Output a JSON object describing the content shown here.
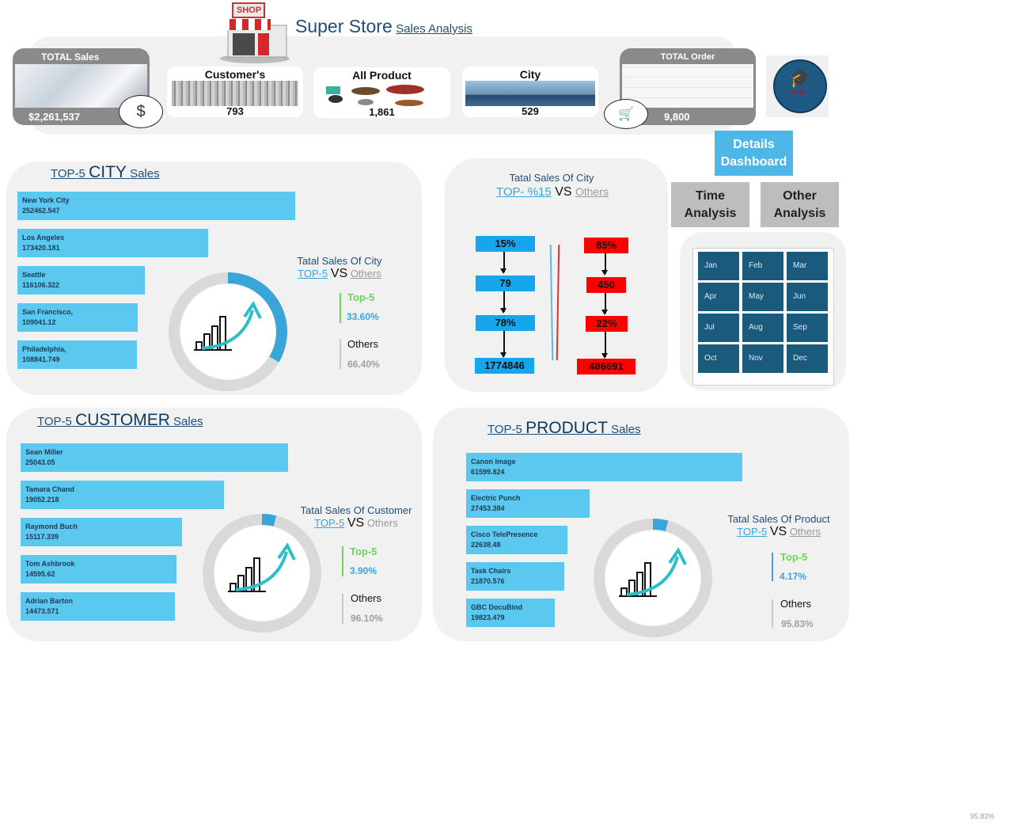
{
  "header": {
    "brand": "Super Store",
    "subtitle": "Sales Analysis",
    "shop_sign": "SHOP"
  },
  "kpis": {
    "total_sales": {
      "label": "TOTAL Sales",
      "value": "$2,261,537"
    },
    "customers": {
      "label": "Customer's",
      "value": "793"
    },
    "products": {
      "label": "All Product",
      "value": "1,861"
    },
    "city": {
      "label": "City",
      "value": "529"
    },
    "total_order": {
      "label": "TOTAL Order",
      "value": "9,800"
    }
  },
  "logo": {
    "text": "College"
  },
  "nav": {
    "details": "Details Dashboard",
    "time": "Time Analysis",
    "other": "Other Analysis"
  },
  "months": [
    "Jan",
    "Feb",
    "Mar",
    "Apr",
    "May",
    "Jun",
    "Jul",
    "Aug",
    "Sep",
    "Oct",
    "Nov",
    "Dec"
  ],
  "city_section": {
    "title_a": "TOP-5 ",
    "title_b": "CITY",
    "title_c": " Sales",
    "legend_title": "Tatal Sales Of City",
    "legend_top5": "TOP-5",
    "legend_vs": "VS",
    "legend_others": "Others",
    "top_label": "Top-5",
    "top_value": "33.60%",
    "others_label": "Others",
    "others_value": "66.40%"
  },
  "customer_section": {
    "title_a": "TOP-5 ",
    "title_b": "CUSTOMER",
    "title_c": " Sales",
    "legend_title": "Tatal Sales Of Customer",
    "legend_top5": "TOP-5",
    "legend_vs": "VS",
    "legend_others": "Others",
    "top_label": "Top-5",
    "top_value": "3.90%",
    "others_label": "Others",
    "others_value": "96.10%"
  },
  "product_section": {
    "title_a": "TOP-5 ",
    "title_b": "PRODUCT",
    "title_c": " Sales",
    "legend_title": "Tatal Sales Of Product",
    "legend_top5": "TOP-5",
    "legend_vs": "VS",
    "legend_others": "Others",
    "top_label": "Top-5",
    "top_value": "4.17%",
    "others_label": "Others",
    "others_value": "95.83%"
  },
  "funnel": {
    "title": "Tatal Sales Of City",
    "top_label": "TOP- %15",
    "vs": "VS",
    "others": "Others",
    "left": [
      "15%",
      "79",
      "78%",
      "1774846"
    ],
    "right": [
      "85%",
      "450",
      "22%",
      "486691"
    ]
  },
  "zoom": "95.83%",
  "colors": {
    "bar": "#5bc8ef",
    "donut_top": "#3aa5d8",
    "donut_rest": "#d9d9d9",
    "title": "#1f4e79",
    "funnel_blue": "#16a6ee",
    "funnel_red": "#ff0000",
    "month_tile": "#1a5a7c"
  },
  "chart_data": [
    {
      "type": "bar",
      "title": "TOP-5 CITY Sales",
      "categories": [
        "New York City",
        "Los Angeles",
        "Seattle",
        "San Francisco,",
        "Philadelphia,"
      ],
      "labels": [
        "252462.547",
        "173420.181",
        "116106.322",
        "109041.12",
        "108841.749"
      ],
      "values": [
        252462.547,
        173420.181,
        116106.322,
        109041.12,
        108841.749
      ]
    },
    {
      "type": "pie",
      "title": "Tatal Sales Of City",
      "categories": [
        "Top-5",
        "Others"
      ],
      "values": [
        33.6,
        66.4
      ]
    },
    {
      "type": "bar",
      "title": "TOP-5 CUSTOMER Sales",
      "categories": [
        "Sean Miller",
        "Tamara Chand",
        "Raymond Buch",
        "Tom Ashbrook",
        "Adrian Barton"
      ],
      "labels": [
        "25043.05",
        "19052.218",
        "15117.339",
        "14595.62",
        " 14473.571"
      ],
      "values": [
        25043.05,
        19052.218,
        15117.339,
        14595.62,
        14473.571
      ]
    },
    {
      "type": "pie",
      "title": "Tatal Sales Of Customer",
      "categories": [
        "Top-5",
        "Others"
      ],
      "values": [
        3.9,
        96.1
      ]
    },
    {
      "type": "bar",
      "title": "TOP-5 PRODUCT Sales",
      "categories": [
        "Canon Image",
        "Electric Punch",
        "Cisco TelePresence",
        "Task Chairs",
        "GBC DocuBind"
      ],
      "labels": [
        " 61599.824",
        "27453.384",
        "22638.48",
        " 21870.576",
        "19823.479"
      ],
      "values": [
        61599.824,
        27453.384,
        22638.48,
        21870.576,
        19823.479
      ]
    },
    {
      "type": "pie",
      "title": "Tatal Sales Of Product",
      "categories": [
        "Top-5",
        "Others"
      ],
      "values": [
        4.17,
        95.83
      ]
    }
  ]
}
